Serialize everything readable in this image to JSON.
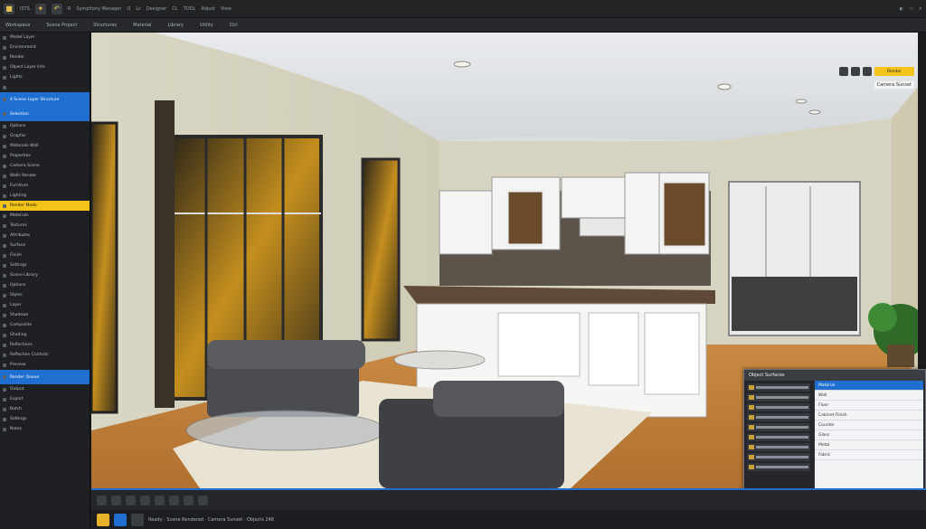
{
  "topbar": {
    "items": [
      "ISTS",
      "R",
      "Symphony Manager",
      "Q",
      "Lc",
      "Designer",
      "CL",
      "TOOL",
      "Adjust",
      "View"
    ],
    "right": [
      "◐",
      "▭",
      "✕"
    ]
  },
  "subbar": {
    "items": [
      "Workspace",
      "Scene Project",
      "Structures",
      "Material",
      "Library",
      "Utility",
      "Ctrl"
    ]
  },
  "left_panel": {
    "rows": [
      {
        "label": "Model Layer",
        "style": "normal"
      },
      {
        "label": "Environment",
        "style": "normal"
      },
      {
        "label": "Render",
        "style": "normal"
      },
      {
        "label": "Object Layer Info",
        "style": "normal"
      },
      {
        "label": "Lights",
        "style": "normal"
      },
      {
        "label": "",
        "style": "normal"
      },
      {
        "label": "4 Scene Layer Structure",
        "style": "blue"
      },
      {
        "label": "Selection",
        "style": "blue"
      },
      {
        "label": "Options",
        "style": "normal"
      },
      {
        "label": "Graphic",
        "style": "normal"
      },
      {
        "label": "Materials Wall",
        "style": "normal"
      },
      {
        "label": "Properties",
        "style": "normal"
      },
      {
        "label": "Camera Scene",
        "style": "normal"
      },
      {
        "label": "Walls Render",
        "style": "normal"
      },
      {
        "label": "Furniture",
        "style": "normal"
      },
      {
        "label": "Lighting",
        "style": "normal"
      },
      {
        "label": "Render Mode",
        "style": "yellow"
      },
      {
        "label": "Materials",
        "style": "normal"
      },
      {
        "label": "Textures",
        "style": "normal"
      },
      {
        "label": "Attributes",
        "style": "normal"
      },
      {
        "label": "Surface",
        "style": "normal"
      },
      {
        "label": "Finish",
        "style": "normal"
      },
      {
        "label": "Settings",
        "style": "normal"
      },
      {
        "label": "Scene Library",
        "style": "normal"
      },
      {
        "label": "Options",
        "style": "normal"
      },
      {
        "label": "Styles",
        "style": "normal"
      },
      {
        "label": "Layer",
        "style": "normal"
      },
      {
        "label": "Shadows",
        "style": "normal"
      },
      {
        "label": "Composite",
        "style": "normal"
      },
      {
        "label": "Shading",
        "style": "normal"
      },
      {
        "label": "Reflections",
        "style": "normal"
      },
      {
        "label": "Reflection Controls",
        "style": "normal"
      },
      {
        "label": "Preview",
        "style": "normal"
      },
      {
        "label": "Render Queue",
        "style": "blue"
      },
      {
        "label": "Output",
        "style": "normal"
      },
      {
        "label": "Export",
        "style": "normal"
      },
      {
        "label": "Batch",
        "style": "normal"
      },
      {
        "label": "Settings",
        "style": "normal"
      },
      {
        "label": "Notes",
        "style": "normal"
      }
    ]
  },
  "viewport": {
    "tools_label": "Render",
    "label": "Camera Sunset"
  },
  "props": {
    "title": "Object Surfaces",
    "rows": [
      "Material",
      "Wall",
      "Floor",
      "Cabinet Finish",
      "Counter",
      "Glass",
      "Metal",
      "Fabric"
    ]
  },
  "statusbar": {
    "text": "Ready · Scene Rendered · Camera Sunset · Objects 248"
  },
  "colors": {
    "accent": "#1f6fd1",
    "highlight": "#f2c318",
    "panel": "#1f2023"
  }
}
